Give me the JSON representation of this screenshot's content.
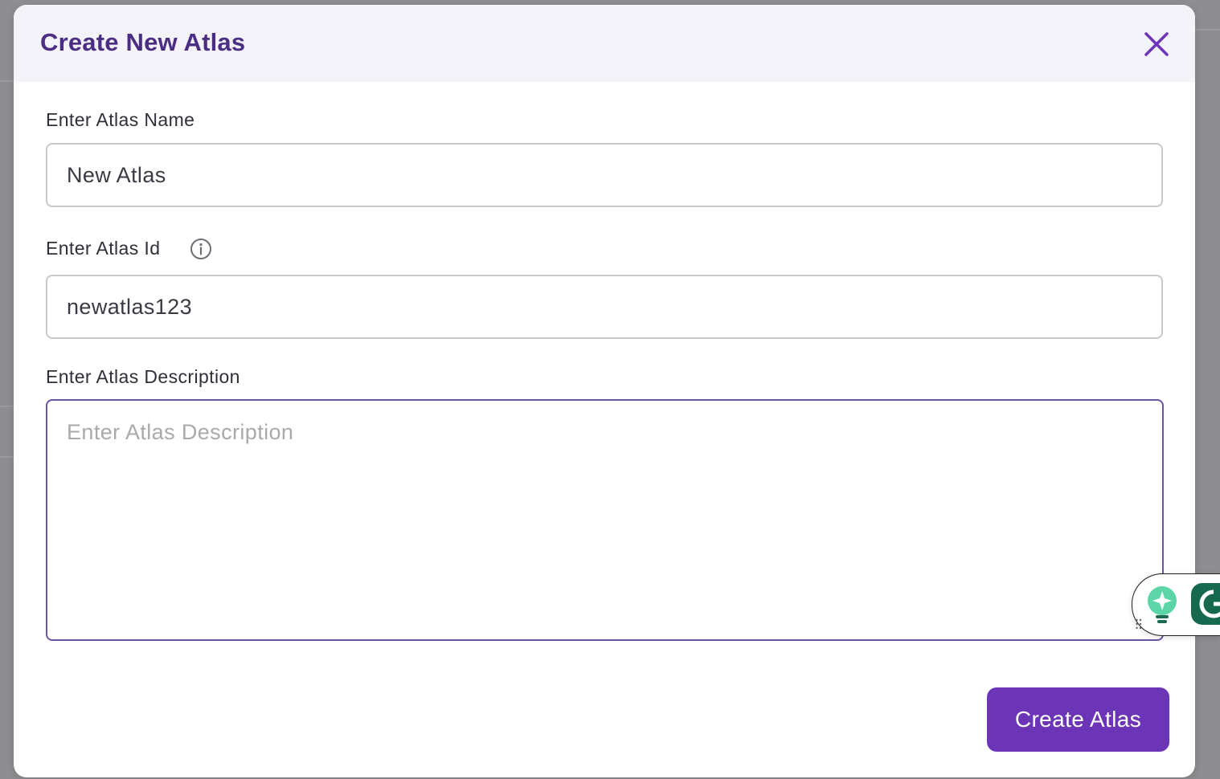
{
  "modal": {
    "title": "Create New Atlas",
    "close_icon": "close-icon"
  },
  "fields": {
    "name": {
      "label": "Enter Atlas Name",
      "value": "New Atlas"
    },
    "id": {
      "label": "Enter Atlas Id",
      "value": "newatlas123",
      "info_icon": "info-icon"
    },
    "description": {
      "label": "Enter Atlas Description",
      "value": "",
      "placeholder": "Enter Atlas Description"
    }
  },
  "actions": {
    "create_label": "Create Atlas"
  },
  "colors": {
    "accent": "#6c34b7",
    "title": "#4b2e83",
    "header_bg": "#f4f3fa",
    "focus_border": "#6a55a3",
    "backdrop": "#8e8e91"
  },
  "assist_widget": {
    "icons": [
      "grip-icon",
      "lightbulb-sparkle-icon",
      "grammarly-g-icon"
    ]
  }
}
